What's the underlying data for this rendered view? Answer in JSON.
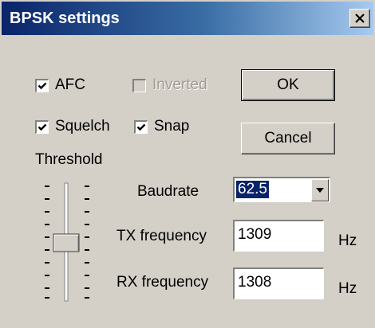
{
  "window": {
    "title": "BPSK settings",
    "close_glyph": "×"
  },
  "options": {
    "afc": {
      "label": "AFC",
      "checked": true,
      "enabled": true
    },
    "inverted": {
      "label": "Inverted",
      "checked": false,
      "enabled": false
    },
    "squelch": {
      "label": "Squelch",
      "checked": true,
      "enabled": true
    },
    "snap": {
      "label": "Snap",
      "checked": true,
      "enabled": true
    }
  },
  "threshold": {
    "label": "Threshold",
    "level": 0.5
  },
  "baudrate": {
    "label": "Baudrate",
    "value": "62.5"
  },
  "tx": {
    "label": "TX frequency",
    "value": "1309",
    "unit": "Hz"
  },
  "rx": {
    "label": "RX frequency",
    "value": "1308",
    "unit": "Hz"
  },
  "buttons": {
    "ok": "OK",
    "cancel": "Cancel"
  },
  "colors": {
    "titlebar_start": "#0a246a",
    "titlebar_end": "#a6caf0",
    "face": "#d4d0c8"
  },
  "icons": {
    "close": "close-icon",
    "dropdown": "chevron-down-icon",
    "check": "check-icon"
  }
}
